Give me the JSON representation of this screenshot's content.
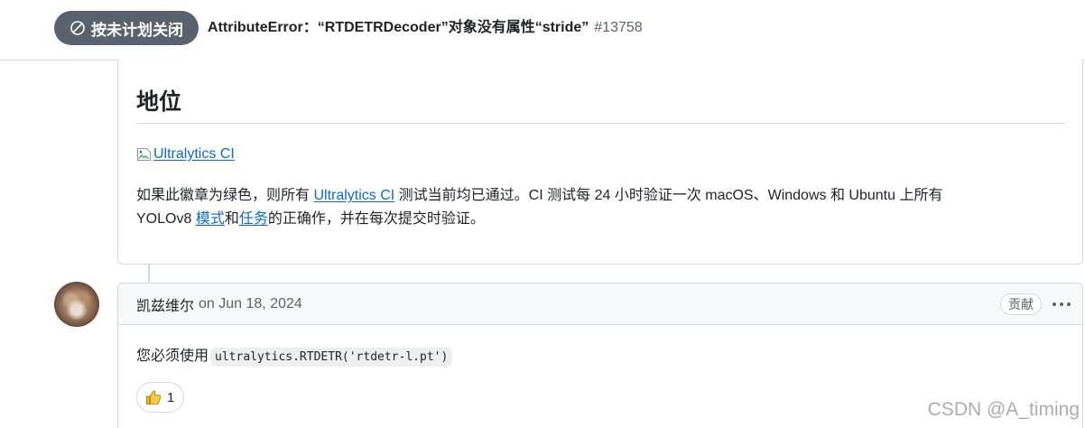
{
  "colors": {
    "state_closed_not_planned": "#59636e",
    "text": "#1f2328",
    "muted": "#59636e",
    "link": "#0969da",
    "border": "#d1d9e0",
    "comment_header_bg": "#f6f8fa"
  },
  "issue_header": {
    "state_badge": {
      "icon": "skip-icon",
      "label": "按未计划关闭"
    },
    "title": "AttributeError：“RTDETRDecoder”对象没有属性“stride”",
    "number": "#13758"
  },
  "previous_comment": {
    "heading": "地位",
    "ci_badge": {
      "icon": "broken-image-icon",
      "alt": "Ultralytics CI"
    },
    "paragraph": {
      "text_1": "如果此徽章为绿色，则所有 ",
      "link_1": "Ultralytics CI",
      "text_2": " 测试当前均已通过。CI 测试每 24 小时验证一次 macOS、Windows 和 Ubuntu 上所有",
      "text_3": "YOLOv8 ",
      "link_2": "模式",
      "text_4": "和",
      "link_3": "任务",
      "text_5": "的正确作，并在每次提交时验证。"
    }
  },
  "comment": {
    "author": "凯兹维尔",
    "timestamp": "on Jun 18, 2024",
    "role_badge": "贡献",
    "menu_icon": "kebab-horizontal-icon",
    "body": {
      "text": "您必须使用",
      "code": "ultralytics.RTDETR('rtdetr-l.pt')"
    },
    "reactions": [
      {
        "icon": "thumbs-up-icon",
        "count": "1"
      }
    ]
  },
  "watermark": "CSDN @A_timing"
}
